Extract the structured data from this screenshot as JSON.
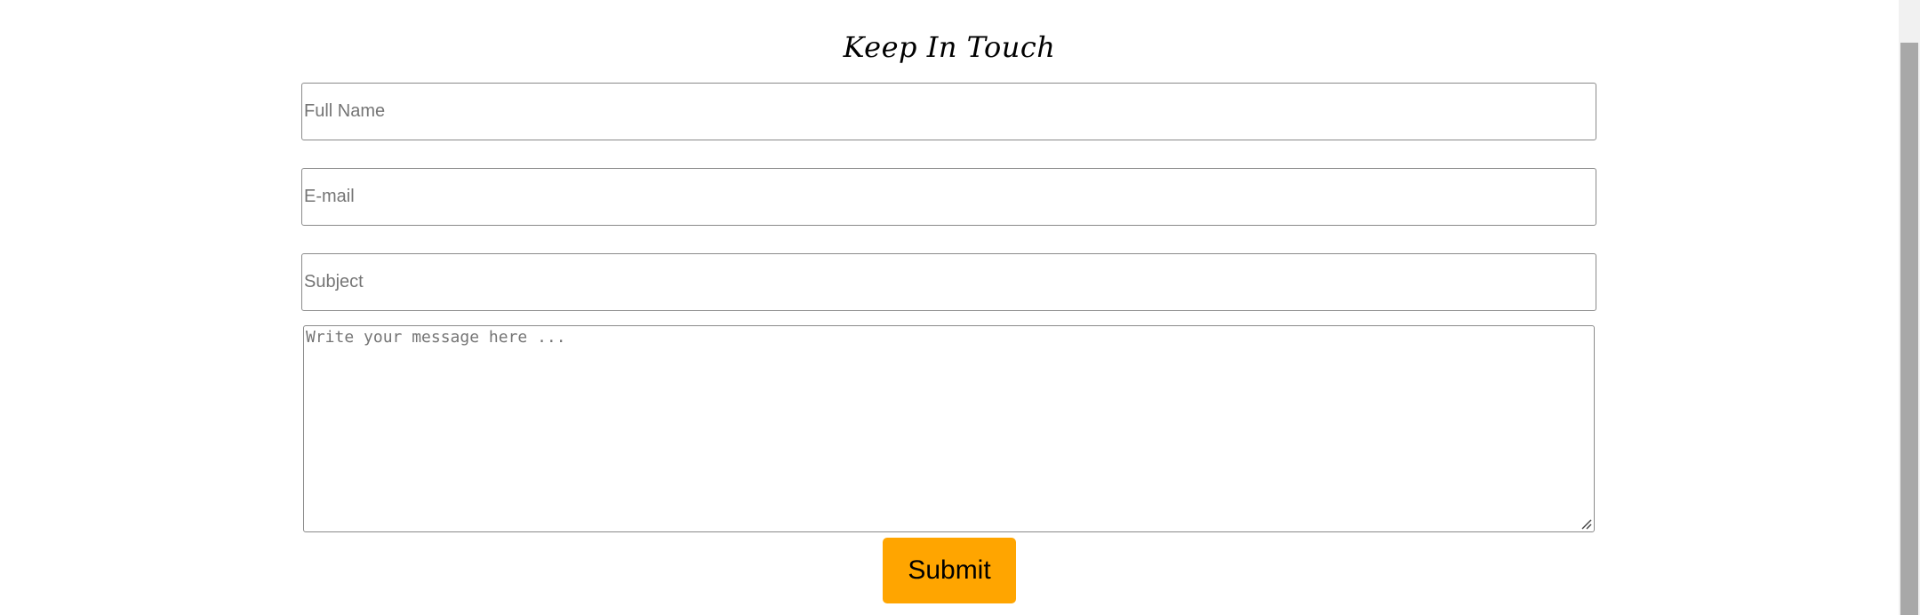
{
  "form": {
    "title": "Keep In Touch",
    "full_name_placeholder": "Full Name",
    "email_placeholder": "E-mail",
    "subject_placeholder": "Subject",
    "message_placeholder": "Write your message here ...",
    "submit_label": "Submit"
  },
  "colors": {
    "submit_background": "#ffa500",
    "placeholder_text": "#757575",
    "field_border": "#8a8a8a"
  },
  "icons": {
    "resize": "resize-grip-icon"
  }
}
